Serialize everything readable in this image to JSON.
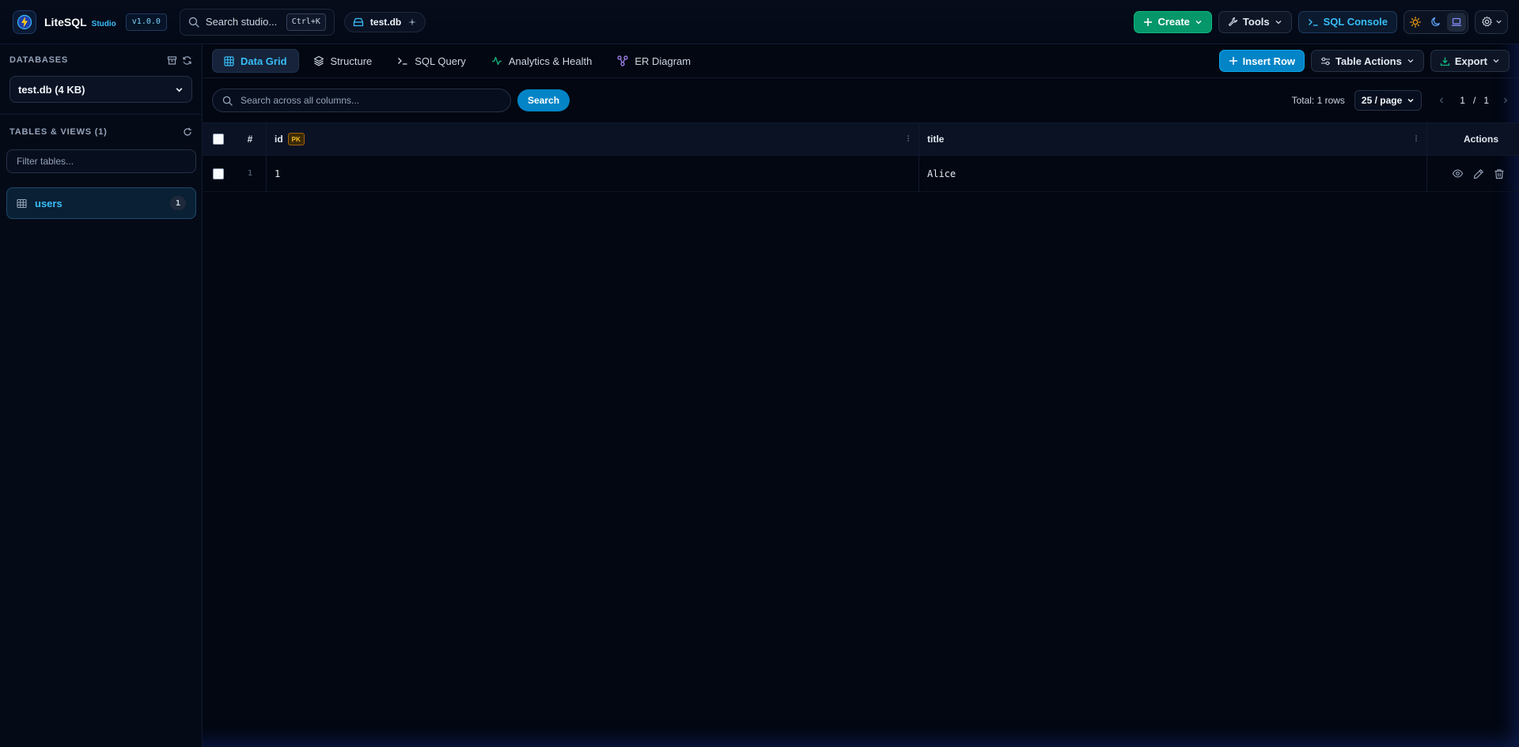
{
  "header": {
    "brand_name": "LiteSQL",
    "brand_sub": "Studio",
    "version": "v1.0.0",
    "search_placeholder": "Search studio...",
    "search_shortcut": "Ctrl+K",
    "db_chip": "test.db",
    "create_label": "Create",
    "tools_label": "Tools",
    "console_label": "SQL Console",
    "accent_color": "#38bdf8",
    "create_color": "#059669"
  },
  "sidebar": {
    "databases_title": "DATABASES",
    "selected_db": "test.db (4 KB)",
    "tables_title": "TABLES & VIEWS (1)",
    "filter_placeholder": "Filter tables...",
    "tables": [
      {
        "name": "users",
        "count": "1"
      }
    ]
  },
  "tabs": [
    {
      "label": "Data Grid",
      "active": true
    },
    {
      "label": "Structure"
    },
    {
      "label": "SQL Query"
    },
    {
      "label": "Analytics & Health"
    },
    {
      "label": "ER Diagram"
    }
  ],
  "tab_actions": {
    "insert_label": "Insert Row",
    "table_actions_label": "Table Actions",
    "export_label": "Export"
  },
  "toolbar": {
    "search_placeholder": "Search across all columns...",
    "search_button": "Search",
    "total": "Total: 1 rows",
    "page_size": "25 / page",
    "page_current": "1",
    "page_sep": "/",
    "page_total": "1"
  },
  "grid": {
    "num_header": "#",
    "columns": [
      "id",
      "title"
    ],
    "pk_badge": "PK",
    "actions_header": "Actions",
    "rows": [
      {
        "num": "1",
        "id": "1",
        "title": "Alice"
      }
    ]
  }
}
